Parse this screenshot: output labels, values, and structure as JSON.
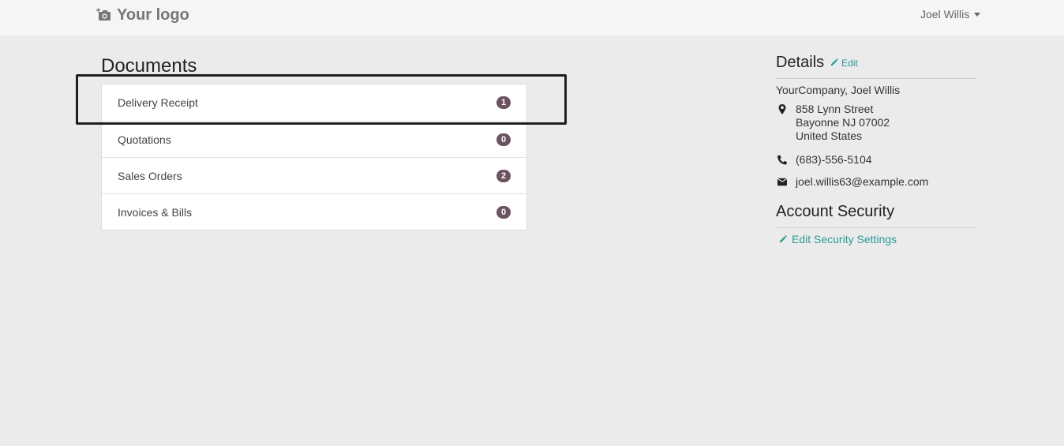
{
  "navbar": {
    "logo_text": "Your logo",
    "user_name": "Joel Willis"
  },
  "documents": {
    "title": "Documents",
    "items": [
      {
        "label": "Delivery Receipt",
        "count": "1"
      },
      {
        "label": "Quotations",
        "count": "0"
      },
      {
        "label": "Sales Orders",
        "count": "2"
      },
      {
        "label": "Invoices & Bills",
        "count": "0"
      }
    ]
  },
  "details": {
    "title": "Details",
    "edit_label": "Edit",
    "company": "YourCompany, Joel Willis",
    "address_line1": "858 Lynn Street",
    "address_line2": "Bayonne NJ 07002",
    "address_line3": "United States",
    "phone": "(683)-556-5104",
    "email": "joel.willis63@example.com"
  },
  "security": {
    "title": "Account Security",
    "edit_link": "Edit Security Settings"
  },
  "colors": {
    "accent": "#2a9b9b",
    "badge": "#6b5460",
    "background": "#ebebeb"
  }
}
